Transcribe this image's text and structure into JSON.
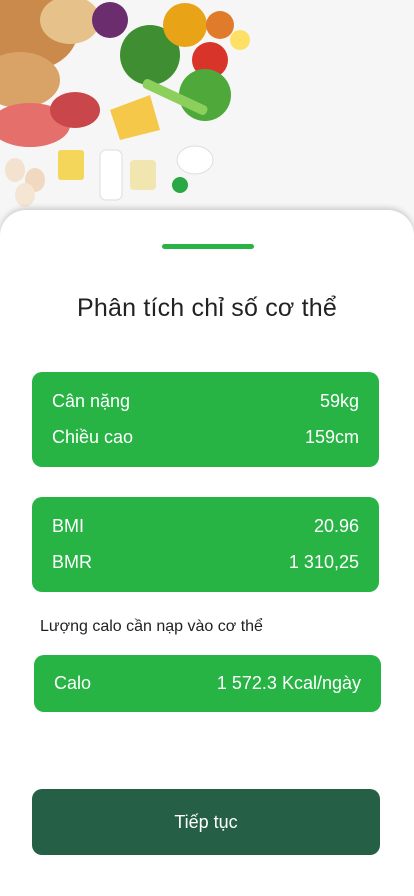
{
  "hero": {
    "image": "vegetables-food-illustration"
  },
  "sheet": {
    "title": "Phân tích chỉ số cơ thể",
    "body_card": {
      "rows": [
        {
          "label": "Cân nặng",
          "value": "59kg"
        },
        {
          "label": "Chiều cao",
          "value": "159cm"
        }
      ]
    },
    "index_card": {
      "rows": [
        {
          "label": "BMI",
          "value": "20.96"
        },
        {
          "label": "BMR",
          "value": "1 310,25"
        }
      ]
    },
    "calorie_heading": "Lượng calo cần nạp vào cơ thể",
    "calorie_card": {
      "label": "Calo",
      "value": "1 572.3 Kcal/ngày"
    },
    "continue_label": "Tiếp tục"
  },
  "colors": {
    "accent": "#27b445",
    "button": "#255f45"
  }
}
